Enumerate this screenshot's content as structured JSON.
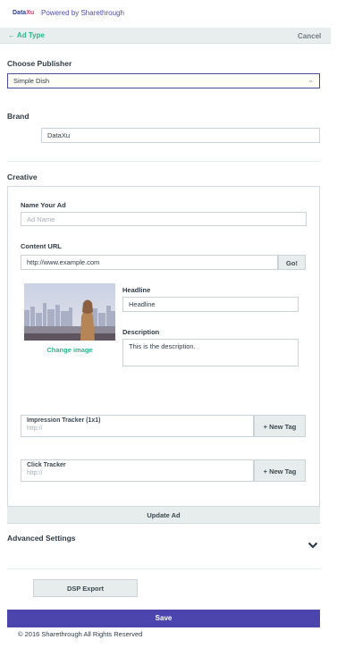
{
  "header": {
    "logo_part1": "Data",
    "logo_part2": "Xu",
    "powered_by": "Powered by Sharethrough"
  },
  "topbar": {
    "back_label": "← Ad Type",
    "cancel_label": "Cancel"
  },
  "publisher": {
    "label": "Choose Publisher",
    "selected": "Simple Dish"
  },
  "brand": {
    "label": "Brand",
    "value": "DataXu"
  },
  "creative": {
    "label": "Creative",
    "name_label": "Name Your Ad",
    "name_placeholder": "Ad Name",
    "url_label": "Content URL",
    "url_value": "http://www.example.com",
    "go_label": "Go!",
    "change_image": "Change image",
    "headline_label": "Headline",
    "headline_value": "Headline",
    "description_label": "Description",
    "description_value": "This is the description.",
    "impression_label": "Impression Tracker (1x1)",
    "impression_placeholder": "http://",
    "click_label": "Click Tracker",
    "click_placeholder": "http://",
    "new_tag_label": "+ New Tag",
    "update_label": "Update Ad"
  },
  "advanced": {
    "label": "Advanced Settings"
  },
  "dsp_export_label": "DSP Export",
  "save_label": "Save",
  "footer": "© 2016 Sharethrough All Rights Reserved",
  "colors": {
    "accent_green": "#2bb68a",
    "brand_purple": "#4c45ae",
    "topbar_bg": "#e8eeee"
  }
}
